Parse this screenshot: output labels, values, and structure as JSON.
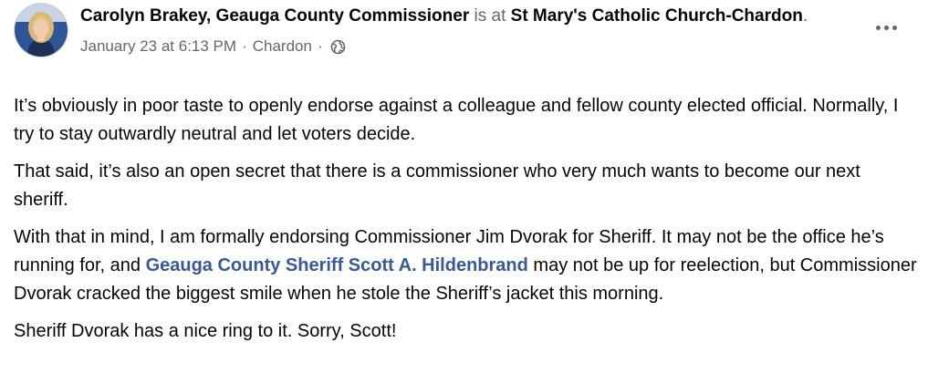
{
  "post": {
    "author": "Carolyn Brakey, Geauga County Commissioner",
    "is_at": "is at",
    "location": "St Mary's Catholic Church-Chardon",
    "location_end": ".",
    "time": "January 23 at 6:13 PM",
    "separator": "·",
    "place": "Chardon",
    "privacy_icon": "globe-icon",
    "more_icon": "more-options-icon",
    "paragraphs": {
      "p1": "It’s obviously in poor taste to openly endorse against a colleague and fellow county elected official. Normally, I try to stay outwardly neutral and let voters decide.",
      "p2": "That said, it’s also an open secret that there is a commissioner who very much wants to become our next sheriff.",
      "p3_before": "With that in mind, I am formally endorsing Commissioner Jim Dvorak for Sheriff. It may not be the office he’s running for, and ",
      "p3_mention": "Geauga County Sheriff Scott A. Hildenbrand",
      "p3_after": " may not be up for reelection, but Commissioner Dvorak cracked the biggest smile when he stole the Sheriff’s jacket this morning.",
      "p4": "Sheriff Dvorak has a nice ring to it. Sorry, Scott!"
    }
  },
  "colors": {
    "text": "#050505",
    "muted": "#65676b",
    "mention": "#385898"
  }
}
